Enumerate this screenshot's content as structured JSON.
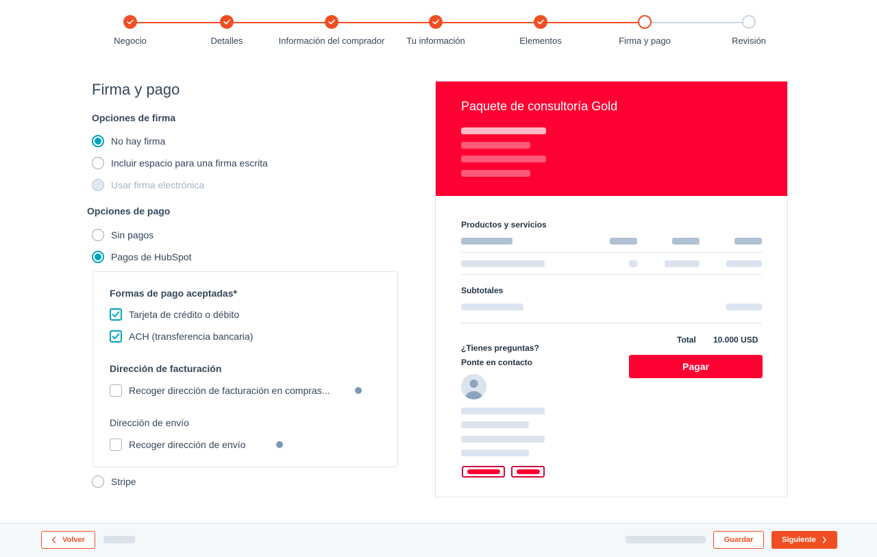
{
  "colors": {
    "accent": "#f04e23",
    "brand_red": "#ff0033",
    "radio_teal": "#00a4bd",
    "text": "#33475b",
    "todo_gray": "#cbd6e2"
  },
  "stepper": {
    "steps": [
      {
        "label": "Negocio",
        "state": "done",
        "icon": "check-icon"
      },
      {
        "label": "Detalles",
        "state": "done",
        "icon": "check-icon"
      },
      {
        "label": "Información del comprador",
        "state": "done",
        "icon": "check-icon"
      },
      {
        "label": "Tu información",
        "state": "done",
        "icon": "check-icon"
      },
      {
        "label": "Elementos",
        "state": "done",
        "icon": "check-icon"
      },
      {
        "label": "Firma y pago",
        "state": "current"
      },
      {
        "label": "Revisión",
        "state": "todo"
      }
    ]
  },
  "form": {
    "title": "Firma y pago",
    "signature": {
      "heading": "Opciones de firma",
      "options": [
        {
          "label": "No hay firma",
          "checked": true,
          "disabled": false
        },
        {
          "label": "Incluir espacio para una firma escrita",
          "checked": false,
          "disabled": false
        },
        {
          "label": "Usar firma electrónica",
          "checked": false,
          "disabled": true
        }
      ]
    },
    "payment": {
      "heading": "Opciones de pago",
      "options": [
        {
          "label": "Sin pagos",
          "checked": false
        },
        {
          "label": "Pagos de HubSpot",
          "checked": true
        },
        {
          "label": "Stripe",
          "checked": false
        }
      ],
      "hubspot_box": {
        "methods_heading": "Formas de pago aceptadas*",
        "methods": [
          {
            "label": "Tarjeta de crédito o débito",
            "checked": true
          },
          {
            "label": "ACH (transferencia bancaria)",
            "checked": true
          }
        ],
        "billing_heading": "Dirección de facturación",
        "billing_option": {
          "label": "Recoger dirección de facturación en compras...",
          "checked": false
        },
        "shipping_heading": "Dirección de envío",
        "shipping_option": {
          "label": "Recoger dirección de envío",
          "checked": false
        }
      }
    }
  },
  "preview": {
    "title": "Paquete de consultoría Gold",
    "products_heading": "Productos y servicios",
    "subtotals_heading": "Subtotales",
    "total_label": "Total",
    "total_value": "10.000 USD",
    "questions_label": "¿Tienes preguntas?",
    "contact_label": "Ponte en contacto",
    "pay_button": "Pagar"
  },
  "footer": {
    "back_button": "Volver",
    "save_button": "Guardar",
    "next_button": "Siguiente"
  }
}
